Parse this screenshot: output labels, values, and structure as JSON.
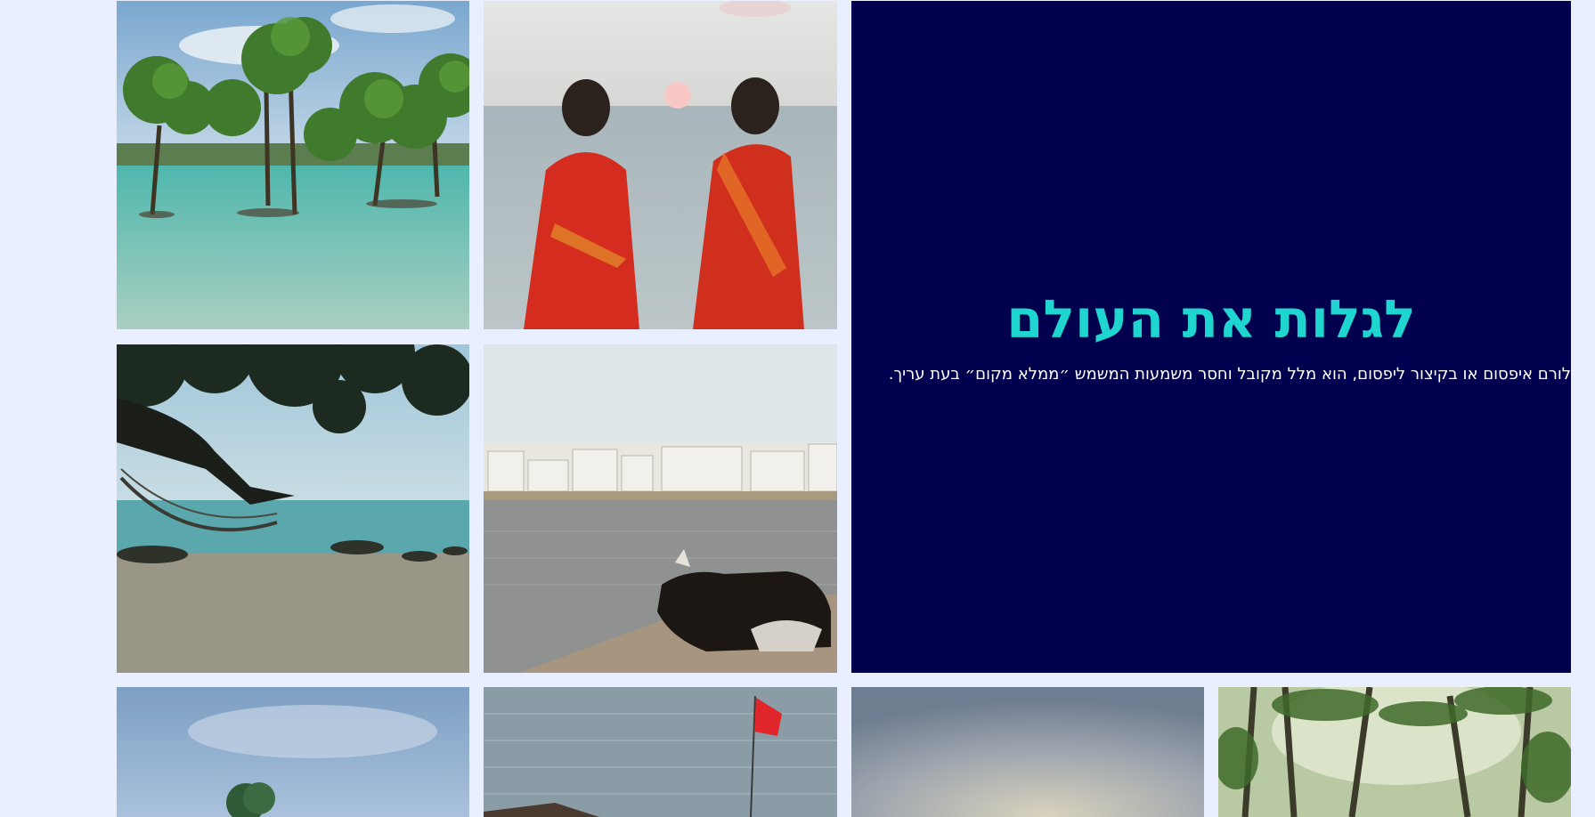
{
  "hero": {
    "title": "לגלות את העולם",
    "text": "לורם איפסום או בקיצור ליפסום, הוא מלל מקובל וחסר משמעות המשמש ״ממלא מקום״ בעת עריך."
  },
  "gallery": [
    {
      "name": "mangrove-trees-photo"
    },
    {
      "name": "women-in-saris-sunset-photo"
    },
    {
      "name": "beach-hammock-photo"
    },
    {
      "name": "lake-town-cow-photo"
    },
    {
      "name": "cloudy-sea-photo"
    },
    {
      "name": "red-flag-sea-photo"
    },
    {
      "name": "hazy-sky-photo"
    },
    {
      "name": "palm-forest-photo"
    }
  ],
  "colors": {
    "background": "#e9efff",
    "hero_background": "#00004e",
    "hero_title": "#1fd5cf",
    "hero_text": "#ffffff"
  }
}
